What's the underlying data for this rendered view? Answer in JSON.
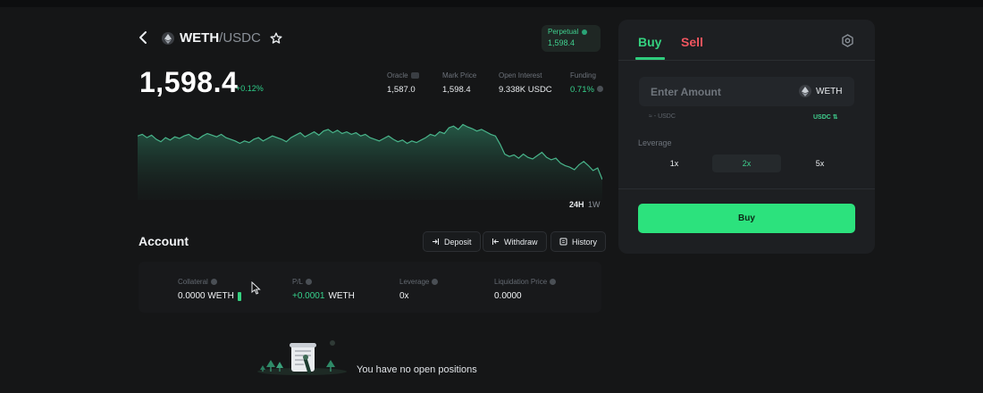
{
  "header": {
    "pair_base": "WETH",
    "pair_quote": "/USDC",
    "perp_label": "Perpetual",
    "perp_value": "1,598.4",
    "price": "1,598.4",
    "change": "+0.12%"
  },
  "stats": [
    {
      "label": "Oracle",
      "value": "1,587.0"
    },
    {
      "label": "Mark Price",
      "value": "1,598.4"
    },
    {
      "label": "Open Interest",
      "value": "9.338K USDC"
    },
    {
      "label": "Funding",
      "value": "0.71%"
    }
  ],
  "chart": {
    "ranges": [
      "24H",
      "1W"
    ],
    "active_range": "24H"
  },
  "chart_data": {
    "type": "area",
    "title": "",
    "xlabel": "",
    "ylabel": "",
    "x": [
      0,
      1,
      2,
      3,
      4,
      5,
      6,
      7,
      8,
      9,
      10,
      11,
      12,
      13,
      14,
      15,
      16,
      17,
      18,
      19,
      20,
      21,
      22,
      23,
      24,
      25,
      26,
      27,
      28,
      29,
      30,
      31,
      32,
      33,
      34,
      35,
      36,
      37,
      38,
      39,
      40,
      41,
      42,
      43,
      44,
      45,
      46,
      47,
      48,
      49,
      50,
      51,
      52,
      53,
      54,
      55,
      56,
      57,
      58,
      59,
      60,
      61,
      62,
      63,
      64,
      65,
      66,
      67,
      68,
      69,
      70,
      71,
      72,
      73,
      74,
      75,
      76,
      77,
      78,
      79,
      80,
      81,
      82,
      83,
      84,
      85,
      86,
      87,
      88,
      89,
      90,
      91,
      92,
      93,
      94,
      95,
      96,
      97,
      98,
      99,
      100
    ],
    "values": [
      78,
      80,
      76,
      79,
      74,
      71,
      76,
      73,
      77,
      75,
      78,
      80,
      76,
      74,
      78,
      81,
      79,
      77,
      80,
      76,
      74,
      72,
      69,
      72,
      70,
      74,
      76,
      72,
      75,
      78,
      76,
      74,
      71,
      76,
      79,
      82,
      77,
      80,
      83,
      79,
      84,
      86,
      82,
      85,
      81,
      83,
      80,
      82,
      78,
      80,
      76,
      74,
      72,
      75,
      78,
      74,
      71,
      73,
      69,
      72,
      70,
      73,
      76,
      80,
      78,
      83,
      81,
      88,
      90,
      86,
      92,
      89,
      87,
      84,
      86,
      83,
      80,
      78,
      68,
      56,
      53,
      55,
      51,
      56,
      52,
      50,
      54,
      58,
      52,
      49,
      51,
      45,
      42,
      40,
      37,
      43,
      47,
      42,
      36,
      39,
      25
    ],
    "ylim": [
      0,
      100
    ],
    "grid": false
  },
  "account": {
    "title": "Account",
    "buttons": {
      "deposit": "Deposit",
      "withdraw": "Withdraw",
      "history": "History"
    },
    "collateral_label": "Collateral",
    "collateral_value": "0.0000 WETH",
    "pl_label": "P/L",
    "pl_amount": "+0.0001",
    "pl_unit": "WETH",
    "leverage_label": "Leverage",
    "leverage_value": "0x",
    "liq_label": "Liquidation Price",
    "liq_value": "0.0000",
    "empty_text": "You have no open positions"
  },
  "trade": {
    "buy_tab": "Buy",
    "sell_tab": "Sell",
    "amount_placeholder": "Enter Amount",
    "amount_token": "WETH",
    "amount_sub": "≈ -  USDC",
    "unit_switch": "USDC ⇅",
    "leverage_label": "Leverage",
    "leverage_options": [
      "1x",
      "2x",
      "5x"
    ],
    "active_leverage": "2x",
    "buy_button": "Buy"
  },
  "colors": {
    "accent_green": "#2ce27d",
    "sell_red": "#f0555f",
    "chart_line": "#49b58b",
    "background": "#151617"
  },
  "icons": [
    "back-arrow-icon",
    "eth-icon",
    "star-icon",
    "settings-icon",
    "deposit-icon",
    "withdraw-icon",
    "history-icon",
    "info-icon",
    "cursor-icon"
  ]
}
